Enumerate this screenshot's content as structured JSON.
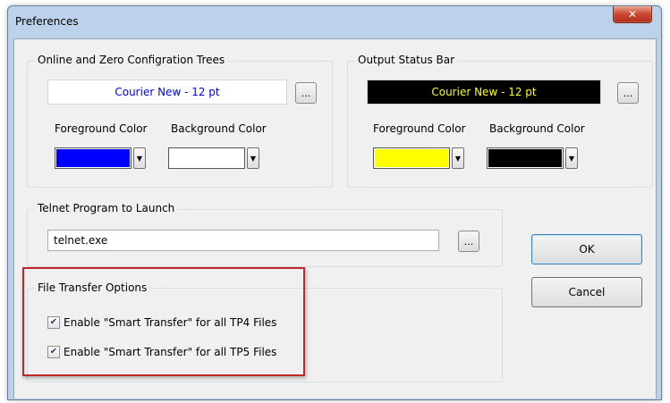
{
  "window": {
    "title": "Preferences",
    "close_glyph": "✕"
  },
  "trees_group": {
    "label": "Online and Zero Configration Trees",
    "font_text": "Courier New - 12 pt",
    "font_color": "#0000ff",
    "font_bg": "#ffffff",
    "ellipsis": "...",
    "foreground_label": "Foreground Color",
    "background_label": "Background Color",
    "foreground_color": "#0000ff",
    "background_color": "#ffffff"
  },
  "status_group": {
    "label": "Output Status Bar",
    "font_text": "Courier New - 12 pt",
    "font_color": "#ffff00",
    "font_bg": "#000000",
    "ellipsis": "...",
    "foreground_label": "Foreground Color",
    "background_label": "Background Color",
    "foreground_color": "#ffff00",
    "background_color": "#000000"
  },
  "telnet_group": {
    "label": "Telnet Program to Launch",
    "value": "telnet.exe",
    "ellipsis": "..."
  },
  "file_transfer_group": {
    "label": "File Transfer Options",
    "options": [
      {
        "label": "Enable \"Smart Transfer\" for all TP4 Files",
        "checked": true
      },
      {
        "label": "Enable \"Smart Transfer\" for all TP5 Files",
        "checked": true
      }
    ]
  },
  "buttons": {
    "ok": "OK",
    "cancel": "Cancel"
  },
  "combo_arrow_glyph": "▼",
  "check_glyph": "✔",
  "highlight_color": "#c0272d"
}
